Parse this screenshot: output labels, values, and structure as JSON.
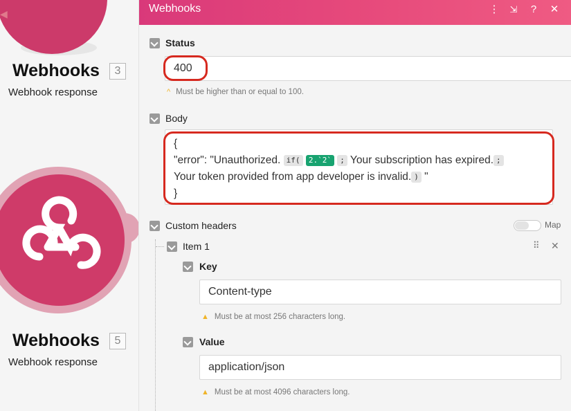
{
  "canvas": {
    "nodes": [
      {
        "title": "Webhooks",
        "count": "3",
        "subtitle": "Webhook response"
      },
      {
        "title": "Webhooks",
        "count": "5",
        "subtitle": "Webhook response"
      }
    ]
  },
  "panel": {
    "title": "Webhooks",
    "header_icons": [
      "more-vertical-icon",
      "collapse-icon",
      "help-icon",
      "close-icon"
    ],
    "accent_colors": {
      "header_start": "#d9397a",
      "header_end": "#ef5b83",
      "highlight": "#d6291f",
      "function_pill": "#18a370"
    },
    "status": {
      "label": "Status",
      "value": "400",
      "hint": "Must be higher than or equal to 100."
    },
    "body": {
      "label": "Body",
      "line1": "{",
      "line2_pre": "\"error\": \"Unauthorized. ",
      "pill_if": "if(",
      "pill_expr": "2.`2`",
      "pill_sep1": ";",
      "line2_mid": " Your subscription has expired.",
      "pill_sep2": ";",
      "line3_text": "Your token provided from app developer is invalid.",
      "pill_close": ")",
      "line3_quote": " \"",
      "line4": "}"
    },
    "custom_headers": {
      "label": "Custom headers",
      "map_label": "Map",
      "item": {
        "label": "Item 1",
        "key": {
          "label": "Key",
          "value": "Content-type",
          "hint": "Must be at most 256 characters long."
        },
        "value": {
          "label": "Value",
          "value": "application/json",
          "hint": "Must be at most 4096 characters long."
        }
      }
    }
  }
}
